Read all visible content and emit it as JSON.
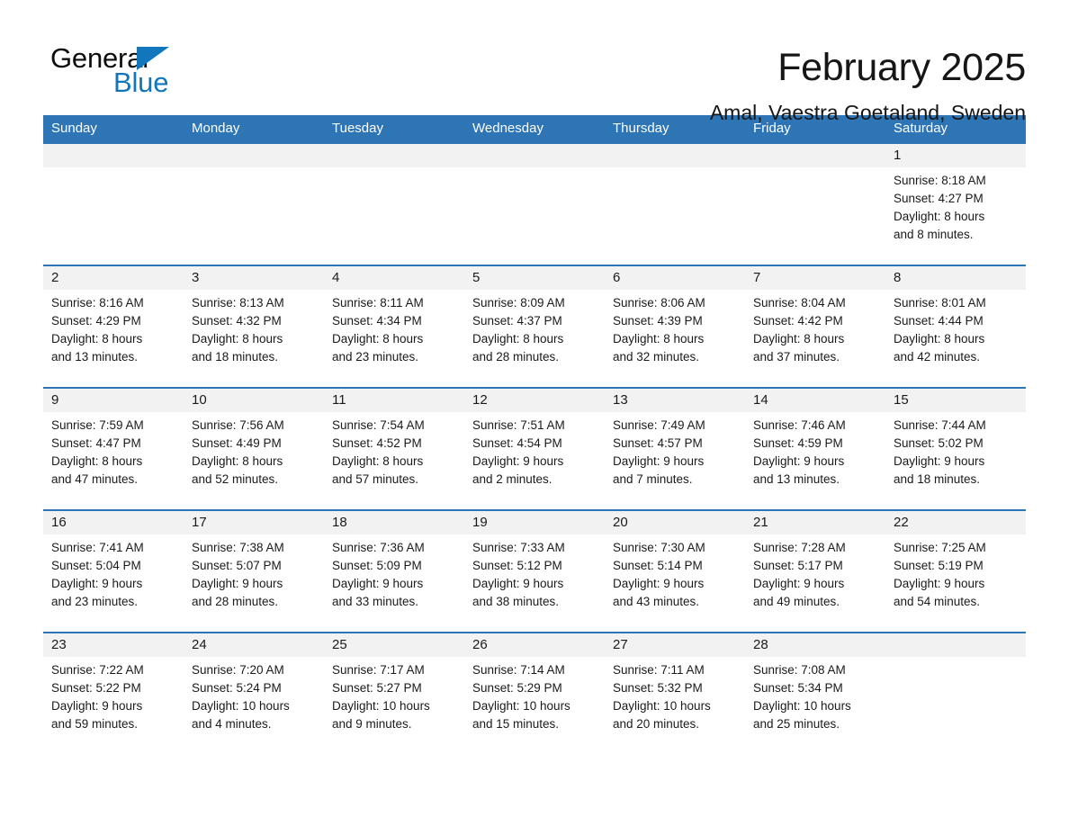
{
  "brand": {
    "name_part1": "General",
    "name_part2": "Blue",
    "accent_color": "#1276bd"
  },
  "header": {
    "month_title": "February 2025",
    "location": "Amal, Vaestra Goetaland, Sweden"
  },
  "theme": {
    "header_blue": "#2e75b6",
    "date_band_gray": "#f2f2f2",
    "text_color": "#1a1a1a"
  },
  "weekdays": [
    "Sunday",
    "Monday",
    "Tuesday",
    "Wednesday",
    "Thursday",
    "Friday",
    "Saturday"
  ],
  "weeks": [
    {
      "days": [
        {
          "date": "",
          "sunrise": "",
          "sunset": "",
          "daylight_line1": "",
          "daylight_line2": ""
        },
        {
          "date": "",
          "sunrise": "",
          "sunset": "",
          "daylight_line1": "",
          "daylight_line2": ""
        },
        {
          "date": "",
          "sunrise": "",
          "sunset": "",
          "daylight_line1": "",
          "daylight_line2": ""
        },
        {
          "date": "",
          "sunrise": "",
          "sunset": "",
          "daylight_line1": "",
          "daylight_line2": ""
        },
        {
          "date": "",
          "sunrise": "",
          "sunset": "",
          "daylight_line1": "",
          "daylight_line2": ""
        },
        {
          "date": "",
          "sunrise": "",
          "sunset": "",
          "daylight_line1": "",
          "daylight_line2": ""
        },
        {
          "date": "1",
          "sunrise": "Sunrise: 8:18 AM",
          "sunset": "Sunset: 4:27 PM",
          "daylight_line1": "Daylight: 8 hours",
          "daylight_line2": "and 8 minutes."
        }
      ]
    },
    {
      "days": [
        {
          "date": "2",
          "sunrise": "Sunrise: 8:16 AM",
          "sunset": "Sunset: 4:29 PM",
          "daylight_line1": "Daylight: 8 hours",
          "daylight_line2": "and 13 minutes."
        },
        {
          "date": "3",
          "sunrise": "Sunrise: 8:13 AM",
          "sunset": "Sunset: 4:32 PM",
          "daylight_line1": "Daylight: 8 hours",
          "daylight_line2": "and 18 minutes."
        },
        {
          "date": "4",
          "sunrise": "Sunrise: 8:11 AM",
          "sunset": "Sunset: 4:34 PM",
          "daylight_line1": "Daylight: 8 hours",
          "daylight_line2": "and 23 minutes."
        },
        {
          "date": "5",
          "sunrise": "Sunrise: 8:09 AM",
          "sunset": "Sunset: 4:37 PM",
          "daylight_line1": "Daylight: 8 hours",
          "daylight_line2": "and 28 minutes."
        },
        {
          "date": "6",
          "sunrise": "Sunrise: 8:06 AM",
          "sunset": "Sunset: 4:39 PM",
          "daylight_line1": "Daylight: 8 hours",
          "daylight_line2": "and 32 minutes."
        },
        {
          "date": "7",
          "sunrise": "Sunrise: 8:04 AM",
          "sunset": "Sunset: 4:42 PM",
          "daylight_line1": "Daylight: 8 hours",
          "daylight_line2": "and 37 minutes."
        },
        {
          "date": "8",
          "sunrise": "Sunrise: 8:01 AM",
          "sunset": "Sunset: 4:44 PM",
          "daylight_line1": "Daylight: 8 hours",
          "daylight_line2": "and 42 minutes."
        }
      ]
    },
    {
      "days": [
        {
          "date": "9",
          "sunrise": "Sunrise: 7:59 AM",
          "sunset": "Sunset: 4:47 PM",
          "daylight_line1": "Daylight: 8 hours",
          "daylight_line2": "and 47 minutes."
        },
        {
          "date": "10",
          "sunrise": "Sunrise: 7:56 AM",
          "sunset": "Sunset: 4:49 PM",
          "daylight_line1": "Daylight: 8 hours",
          "daylight_line2": "and 52 minutes."
        },
        {
          "date": "11",
          "sunrise": "Sunrise: 7:54 AM",
          "sunset": "Sunset: 4:52 PM",
          "daylight_line1": "Daylight: 8 hours",
          "daylight_line2": "and 57 minutes."
        },
        {
          "date": "12",
          "sunrise": "Sunrise: 7:51 AM",
          "sunset": "Sunset: 4:54 PM",
          "daylight_line1": "Daylight: 9 hours",
          "daylight_line2": "and 2 minutes."
        },
        {
          "date": "13",
          "sunrise": "Sunrise: 7:49 AM",
          "sunset": "Sunset: 4:57 PM",
          "daylight_line1": "Daylight: 9 hours",
          "daylight_line2": "and 7 minutes."
        },
        {
          "date": "14",
          "sunrise": "Sunrise: 7:46 AM",
          "sunset": "Sunset: 4:59 PM",
          "daylight_line1": "Daylight: 9 hours",
          "daylight_line2": "and 13 minutes."
        },
        {
          "date": "15",
          "sunrise": "Sunrise: 7:44 AM",
          "sunset": "Sunset: 5:02 PM",
          "daylight_line1": "Daylight: 9 hours",
          "daylight_line2": "and 18 minutes."
        }
      ]
    },
    {
      "days": [
        {
          "date": "16",
          "sunrise": "Sunrise: 7:41 AM",
          "sunset": "Sunset: 5:04 PM",
          "daylight_line1": "Daylight: 9 hours",
          "daylight_line2": "and 23 minutes."
        },
        {
          "date": "17",
          "sunrise": "Sunrise: 7:38 AM",
          "sunset": "Sunset: 5:07 PM",
          "daylight_line1": "Daylight: 9 hours",
          "daylight_line2": "and 28 minutes."
        },
        {
          "date": "18",
          "sunrise": "Sunrise: 7:36 AM",
          "sunset": "Sunset: 5:09 PM",
          "daylight_line1": "Daylight: 9 hours",
          "daylight_line2": "and 33 minutes."
        },
        {
          "date": "19",
          "sunrise": "Sunrise: 7:33 AM",
          "sunset": "Sunset: 5:12 PM",
          "daylight_line1": "Daylight: 9 hours",
          "daylight_line2": "and 38 minutes."
        },
        {
          "date": "20",
          "sunrise": "Sunrise: 7:30 AM",
          "sunset": "Sunset: 5:14 PM",
          "daylight_line1": "Daylight: 9 hours",
          "daylight_line2": "and 43 minutes."
        },
        {
          "date": "21",
          "sunrise": "Sunrise: 7:28 AM",
          "sunset": "Sunset: 5:17 PM",
          "daylight_line1": "Daylight: 9 hours",
          "daylight_line2": "and 49 minutes."
        },
        {
          "date": "22",
          "sunrise": "Sunrise: 7:25 AM",
          "sunset": "Sunset: 5:19 PM",
          "daylight_line1": "Daylight: 9 hours",
          "daylight_line2": "and 54 minutes."
        }
      ]
    },
    {
      "days": [
        {
          "date": "23",
          "sunrise": "Sunrise: 7:22 AM",
          "sunset": "Sunset: 5:22 PM",
          "daylight_line1": "Daylight: 9 hours",
          "daylight_line2": "and 59 minutes."
        },
        {
          "date": "24",
          "sunrise": "Sunrise: 7:20 AM",
          "sunset": "Sunset: 5:24 PM",
          "daylight_line1": "Daylight: 10 hours",
          "daylight_line2": "and 4 minutes."
        },
        {
          "date": "25",
          "sunrise": "Sunrise: 7:17 AM",
          "sunset": "Sunset: 5:27 PM",
          "daylight_line1": "Daylight: 10 hours",
          "daylight_line2": "and 9 minutes."
        },
        {
          "date": "26",
          "sunrise": "Sunrise: 7:14 AM",
          "sunset": "Sunset: 5:29 PM",
          "daylight_line1": "Daylight: 10 hours",
          "daylight_line2": "and 15 minutes."
        },
        {
          "date": "27",
          "sunrise": "Sunrise: 7:11 AM",
          "sunset": "Sunset: 5:32 PM",
          "daylight_line1": "Daylight: 10 hours",
          "daylight_line2": "and 20 minutes."
        },
        {
          "date": "28",
          "sunrise": "Sunrise: 7:08 AM",
          "sunset": "Sunset: 5:34 PM",
          "daylight_line1": "Daylight: 10 hours",
          "daylight_line2": "and 25 minutes."
        },
        {
          "date": "",
          "sunrise": "",
          "sunset": "",
          "daylight_line1": "",
          "daylight_line2": ""
        }
      ]
    }
  ]
}
